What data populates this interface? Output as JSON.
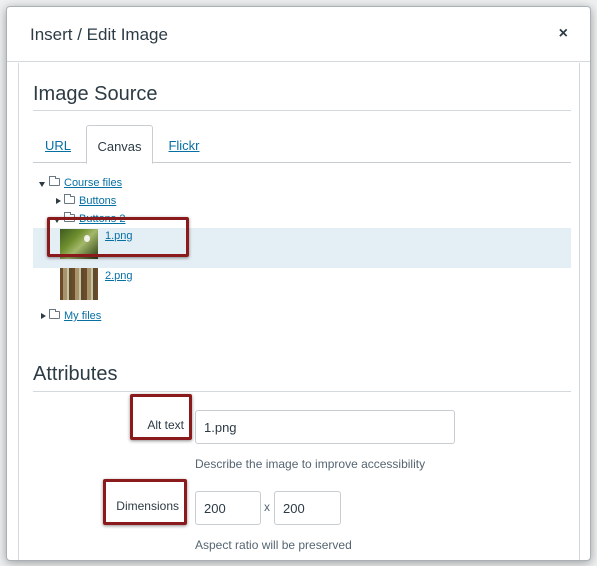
{
  "dialog": {
    "title": "Insert / Edit Image",
    "close_label": "×"
  },
  "image_source": {
    "heading": "Image Source",
    "tabs": [
      {
        "label": "URL",
        "active": false
      },
      {
        "label": "Canvas",
        "active": true
      },
      {
        "label": "Flickr",
        "active": false
      }
    ]
  },
  "file_tree": {
    "root": {
      "label": "Course files",
      "expanded": true
    },
    "folders": [
      {
        "label": "Buttons",
        "expanded": false
      },
      {
        "label": "Buttons 2",
        "expanded": true
      }
    ],
    "files": [
      {
        "label": "1.png",
        "selected": true,
        "thumb_icon": "grass-photo-thumbnail"
      },
      {
        "label": "2.png",
        "selected": false,
        "thumb_icon": "forest-photo-thumbnail"
      }
    ],
    "my_files": {
      "label": "My files",
      "expanded": false
    }
  },
  "attributes": {
    "heading": "Attributes",
    "alt_text": {
      "label": "Alt text",
      "value": "1.png",
      "hint": "Describe the image to improve accessibility"
    },
    "dimensions": {
      "label": "Dimensions",
      "width": "200",
      "separator": "x",
      "height": "200",
      "hint": "Aspect ratio will be preserved"
    }
  },
  "colors": {
    "link": "#0770a3",
    "text": "#2d3b45",
    "selected_row": "#e4eef5",
    "callout": "#8b1a1d"
  }
}
